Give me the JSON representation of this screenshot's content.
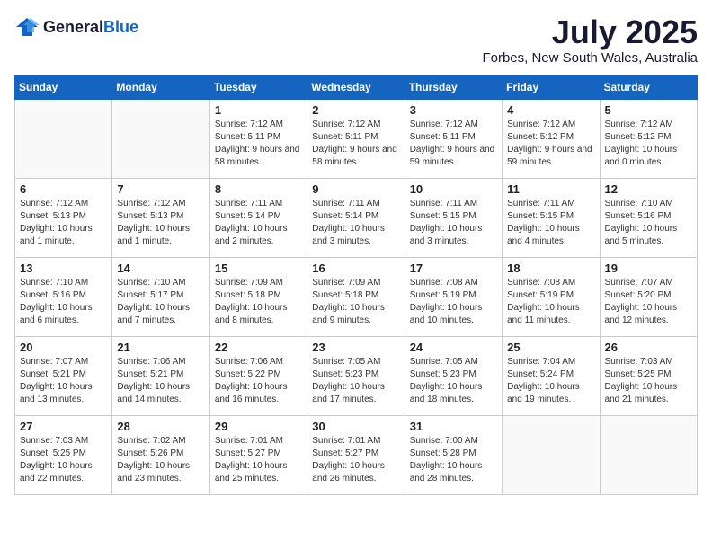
{
  "logo": {
    "general": "General",
    "blue": "Blue"
  },
  "header": {
    "month_year": "July 2025",
    "location": "Forbes, New South Wales, Australia"
  },
  "days_of_week": [
    "Sunday",
    "Monday",
    "Tuesday",
    "Wednesday",
    "Thursday",
    "Friday",
    "Saturday"
  ],
  "weeks": [
    [
      {
        "day": "",
        "sunrise": "",
        "sunset": "",
        "daylight": ""
      },
      {
        "day": "",
        "sunrise": "",
        "sunset": "",
        "daylight": ""
      },
      {
        "day": "1",
        "sunrise": "Sunrise: 7:12 AM",
        "sunset": "Sunset: 5:11 PM",
        "daylight": "Daylight: 9 hours and 58 minutes."
      },
      {
        "day": "2",
        "sunrise": "Sunrise: 7:12 AM",
        "sunset": "Sunset: 5:11 PM",
        "daylight": "Daylight: 9 hours and 58 minutes."
      },
      {
        "day": "3",
        "sunrise": "Sunrise: 7:12 AM",
        "sunset": "Sunset: 5:11 PM",
        "daylight": "Daylight: 9 hours and 59 minutes."
      },
      {
        "day": "4",
        "sunrise": "Sunrise: 7:12 AM",
        "sunset": "Sunset: 5:12 PM",
        "daylight": "Daylight: 9 hours and 59 minutes."
      },
      {
        "day": "5",
        "sunrise": "Sunrise: 7:12 AM",
        "sunset": "Sunset: 5:12 PM",
        "daylight": "Daylight: 10 hours and 0 minutes."
      }
    ],
    [
      {
        "day": "6",
        "sunrise": "Sunrise: 7:12 AM",
        "sunset": "Sunset: 5:13 PM",
        "daylight": "Daylight: 10 hours and 1 minute."
      },
      {
        "day": "7",
        "sunrise": "Sunrise: 7:12 AM",
        "sunset": "Sunset: 5:13 PM",
        "daylight": "Daylight: 10 hours and 1 minute."
      },
      {
        "day": "8",
        "sunrise": "Sunrise: 7:11 AM",
        "sunset": "Sunset: 5:14 PM",
        "daylight": "Daylight: 10 hours and 2 minutes."
      },
      {
        "day": "9",
        "sunrise": "Sunrise: 7:11 AM",
        "sunset": "Sunset: 5:14 PM",
        "daylight": "Daylight: 10 hours and 3 minutes."
      },
      {
        "day": "10",
        "sunrise": "Sunrise: 7:11 AM",
        "sunset": "Sunset: 5:15 PM",
        "daylight": "Daylight: 10 hours and 3 minutes."
      },
      {
        "day": "11",
        "sunrise": "Sunrise: 7:11 AM",
        "sunset": "Sunset: 5:15 PM",
        "daylight": "Daylight: 10 hours and 4 minutes."
      },
      {
        "day": "12",
        "sunrise": "Sunrise: 7:10 AM",
        "sunset": "Sunset: 5:16 PM",
        "daylight": "Daylight: 10 hours and 5 minutes."
      }
    ],
    [
      {
        "day": "13",
        "sunrise": "Sunrise: 7:10 AM",
        "sunset": "Sunset: 5:16 PM",
        "daylight": "Daylight: 10 hours and 6 minutes."
      },
      {
        "day": "14",
        "sunrise": "Sunrise: 7:10 AM",
        "sunset": "Sunset: 5:17 PM",
        "daylight": "Daylight: 10 hours and 7 minutes."
      },
      {
        "day": "15",
        "sunrise": "Sunrise: 7:09 AM",
        "sunset": "Sunset: 5:18 PM",
        "daylight": "Daylight: 10 hours and 8 minutes."
      },
      {
        "day": "16",
        "sunrise": "Sunrise: 7:09 AM",
        "sunset": "Sunset: 5:18 PM",
        "daylight": "Daylight: 10 hours and 9 minutes."
      },
      {
        "day": "17",
        "sunrise": "Sunrise: 7:08 AM",
        "sunset": "Sunset: 5:19 PM",
        "daylight": "Daylight: 10 hours and 10 minutes."
      },
      {
        "day": "18",
        "sunrise": "Sunrise: 7:08 AM",
        "sunset": "Sunset: 5:19 PM",
        "daylight": "Daylight: 10 hours and 11 minutes."
      },
      {
        "day": "19",
        "sunrise": "Sunrise: 7:07 AM",
        "sunset": "Sunset: 5:20 PM",
        "daylight": "Daylight: 10 hours and 12 minutes."
      }
    ],
    [
      {
        "day": "20",
        "sunrise": "Sunrise: 7:07 AM",
        "sunset": "Sunset: 5:21 PM",
        "daylight": "Daylight: 10 hours and 13 minutes."
      },
      {
        "day": "21",
        "sunrise": "Sunrise: 7:06 AM",
        "sunset": "Sunset: 5:21 PM",
        "daylight": "Daylight: 10 hours and 14 minutes."
      },
      {
        "day": "22",
        "sunrise": "Sunrise: 7:06 AM",
        "sunset": "Sunset: 5:22 PM",
        "daylight": "Daylight: 10 hours and 16 minutes."
      },
      {
        "day": "23",
        "sunrise": "Sunrise: 7:05 AM",
        "sunset": "Sunset: 5:23 PM",
        "daylight": "Daylight: 10 hours and 17 minutes."
      },
      {
        "day": "24",
        "sunrise": "Sunrise: 7:05 AM",
        "sunset": "Sunset: 5:23 PM",
        "daylight": "Daylight: 10 hours and 18 minutes."
      },
      {
        "day": "25",
        "sunrise": "Sunrise: 7:04 AM",
        "sunset": "Sunset: 5:24 PM",
        "daylight": "Daylight: 10 hours and 19 minutes."
      },
      {
        "day": "26",
        "sunrise": "Sunrise: 7:03 AM",
        "sunset": "Sunset: 5:25 PM",
        "daylight": "Daylight: 10 hours and 21 minutes."
      }
    ],
    [
      {
        "day": "27",
        "sunrise": "Sunrise: 7:03 AM",
        "sunset": "Sunset: 5:25 PM",
        "daylight": "Daylight: 10 hours and 22 minutes."
      },
      {
        "day": "28",
        "sunrise": "Sunrise: 7:02 AM",
        "sunset": "Sunset: 5:26 PM",
        "daylight": "Daylight: 10 hours and 23 minutes."
      },
      {
        "day": "29",
        "sunrise": "Sunrise: 7:01 AM",
        "sunset": "Sunset: 5:27 PM",
        "daylight": "Daylight: 10 hours and 25 minutes."
      },
      {
        "day": "30",
        "sunrise": "Sunrise: 7:01 AM",
        "sunset": "Sunset: 5:27 PM",
        "daylight": "Daylight: 10 hours and 26 minutes."
      },
      {
        "day": "31",
        "sunrise": "Sunrise: 7:00 AM",
        "sunset": "Sunset: 5:28 PM",
        "daylight": "Daylight: 10 hours and 28 minutes."
      },
      {
        "day": "",
        "sunrise": "",
        "sunset": "",
        "daylight": ""
      },
      {
        "day": "",
        "sunrise": "",
        "sunset": "",
        "daylight": ""
      }
    ]
  ]
}
